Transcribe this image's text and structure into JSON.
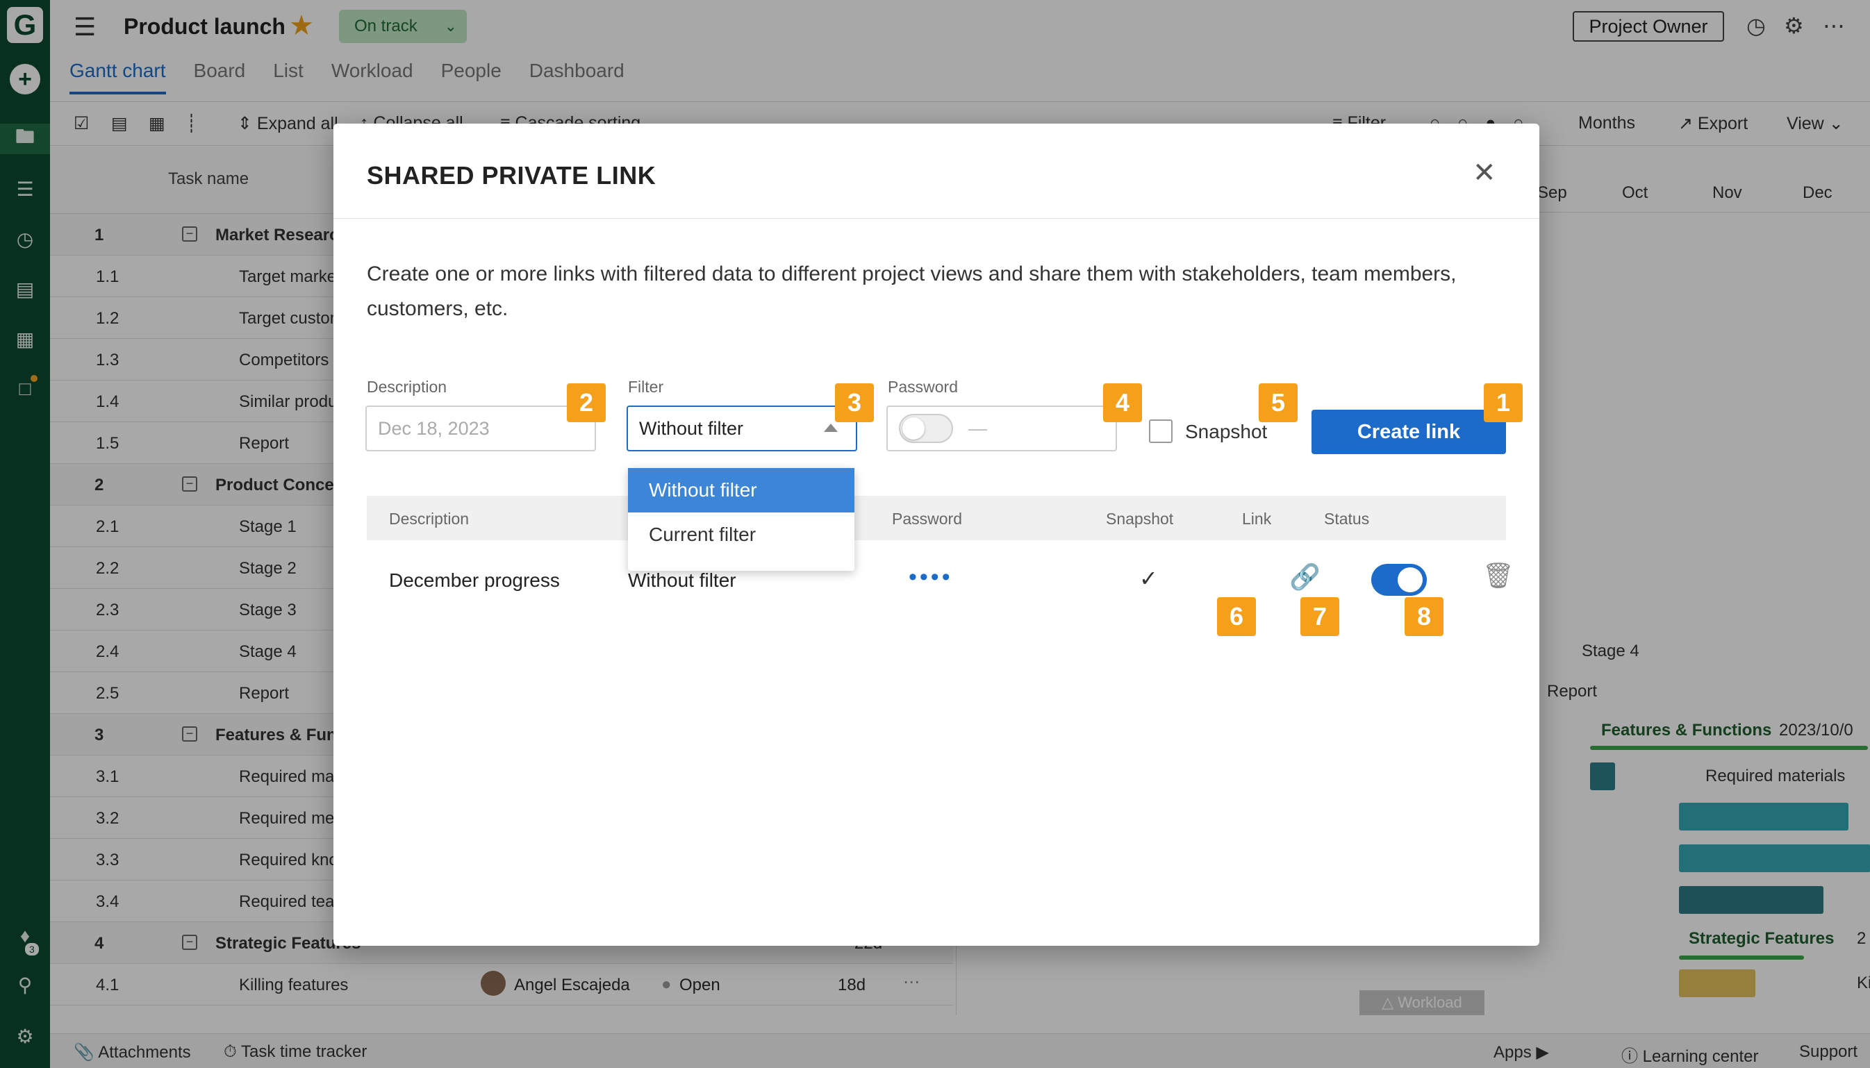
{
  "sidebar": {
    "logo": "G",
    "notification_count": "3"
  },
  "header": {
    "project_title": "Product launch",
    "status": "On track",
    "owner_button": "Project Owner"
  },
  "tabs": [
    {
      "label": "Gantt chart",
      "active": true
    },
    {
      "label": "Board"
    },
    {
      "label": "List"
    },
    {
      "label": "Workload"
    },
    {
      "label": "People"
    },
    {
      "label": "Dashboard"
    }
  ],
  "toolbar": {
    "expand_all": "Expand all",
    "collapse_all": "Collapse all",
    "cascade_sorting": "Cascade sorting",
    "filter": "Filter",
    "zoom_label": "Months",
    "export": "Export",
    "view": "View"
  },
  "grid": {
    "column_task_name": "Task name",
    "rows": [
      {
        "num": "1",
        "name": "Market Research",
        "group": true
      },
      {
        "num": "1.1",
        "name": "Target market"
      },
      {
        "num": "1.2",
        "name": "Target customer"
      },
      {
        "num": "1.3",
        "name": "Competitors"
      },
      {
        "num": "1.4",
        "name": "Similar products"
      },
      {
        "num": "1.5",
        "name": "Report"
      },
      {
        "num": "2",
        "name": "Product Concept",
        "group": true
      },
      {
        "num": "2.1",
        "name": "Stage 1"
      },
      {
        "num": "2.2",
        "name": "Stage 2"
      },
      {
        "num": "2.3",
        "name": "Stage 3"
      },
      {
        "num": "2.4",
        "name": "Stage 4"
      },
      {
        "num": "2.5",
        "name": "Report"
      },
      {
        "num": "3",
        "name": "Features & Functions",
        "group": true
      },
      {
        "num": "3.1",
        "name": "Required materials"
      },
      {
        "num": "3.2",
        "name": "Required methods"
      },
      {
        "num": "3.3",
        "name": "Required knowledge"
      },
      {
        "num": "3.4",
        "name": "Required team"
      },
      {
        "num": "4",
        "name": "Strategic Features",
        "group": true,
        "duration": "22d"
      },
      {
        "num": "4.1",
        "name": "Killing features",
        "assignee": "Angel Escajeda",
        "status": "Open",
        "duration": "18d"
      }
    ]
  },
  "gantt": {
    "months": [
      "Sep",
      "Oct",
      "Nov",
      "Dec"
    ],
    "labels": {
      "stage4": "Stage 4",
      "report": "Report",
      "features": "Features & Functions",
      "features_date": "2023/10/0",
      "required_materials": "Required materials",
      "strategic": "Strategic Features",
      "strategic_num": "2",
      "killing": "Kil"
    },
    "workload_tab": "Workload"
  },
  "bottom_bar": {
    "attachments": "Attachments",
    "time_tracker": "Task time tracker",
    "apps": "Apps",
    "learning_center": "Learning center",
    "support": "Support"
  },
  "modal": {
    "title": "SHARED PRIVATE LINK",
    "description": "Create one or more links with filtered data to different project views and share them with stakeholders, team members, customers, etc.",
    "form": {
      "description_label": "Description",
      "description_placeholder": "Dec 18, 2023",
      "filter_label": "Filter",
      "filter_value": "Without filter",
      "password_label": "Password",
      "password_placeholder": "—",
      "snapshot_label": "Snapshot",
      "create_button": "Create link"
    },
    "dropdown_options": [
      "Without filter",
      "Current filter"
    ],
    "table": {
      "headers": {
        "description": "Description",
        "password": "Password",
        "snapshot": "Snapshot",
        "link": "Link",
        "status": "Status"
      },
      "rows": [
        {
          "description": "December progress",
          "filter": "Without filter",
          "password": "••••",
          "snapshot": "✓",
          "status_on": true
        }
      ]
    },
    "badges": [
      "1",
      "2",
      "3",
      "4",
      "5",
      "6",
      "7",
      "8"
    ]
  },
  "colors": {
    "sidebar": "#0d4a2f",
    "accent": "#1c6bc8",
    "badge": "#f5a01a",
    "status_green": "#bfe6c4"
  }
}
